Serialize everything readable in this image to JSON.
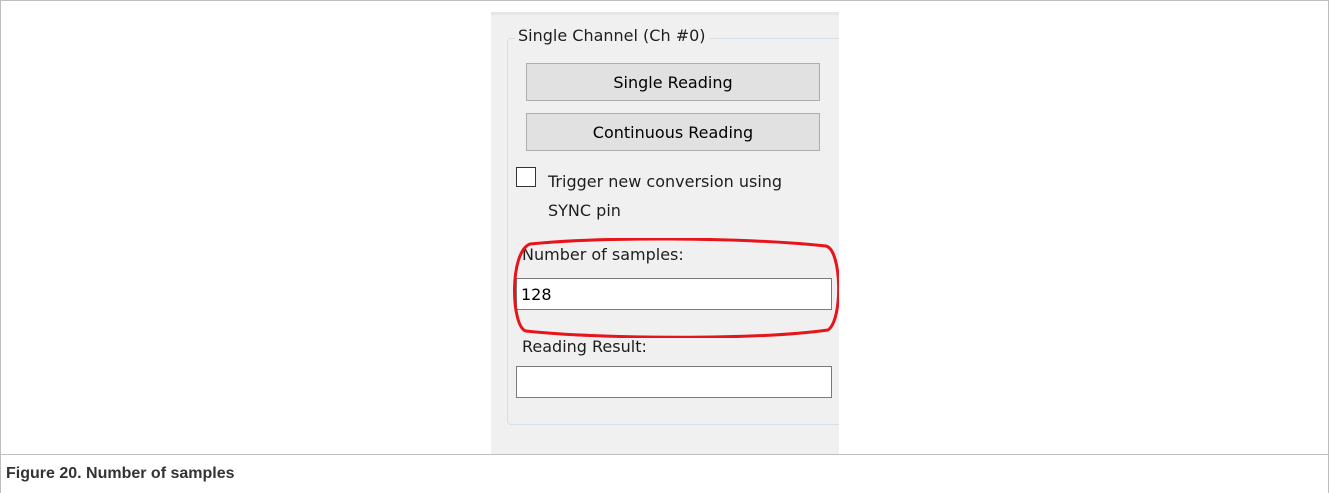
{
  "panel": {
    "group_title": "Single Channel (Ch #0)",
    "single_reading_label": "Single Reading",
    "continuous_reading_label": "Continuous Reading",
    "trigger_checkbox_label": "Trigger new conversion using SYNC pin",
    "trigger_checked": false,
    "samples_label": "Number of samples:",
    "samples_value": "128",
    "result_label": "Reading Result:",
    "result_value": ""
  },
  "annotation": {
    "highlight_color": "#e8141c"
  },
  "caption": {
    "text": "Figure 20.  Number of samples"
  }
}
